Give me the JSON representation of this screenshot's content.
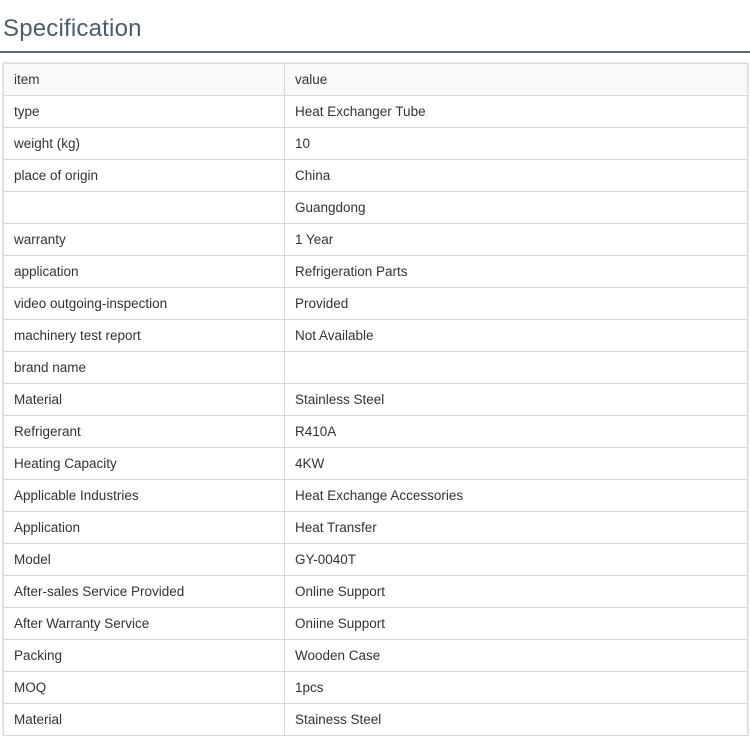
{
  "title": "Specification",
  "table": {
    "header": {
      "item": "item",
      "value": "value"
    },
    "rows": [
      {
        "item": "type",
        "value": "Heat Exchanger Tube"
      },
      {
        "item": "weight (kg)",
        "value": "10"
      },
      {
        "item": "place of origin",
        "value": "China"
      },
      {
        "item": "",
        "value": "Guangdong"
      },
      {
        "item": "warranty",
        "value": "1 Year"
      },
      {
        "item": "application",
        "value": "Refrigeration Parts"
      },
      {
        "item": "video outgoing-inspection",
        "value": "Provided"
      },
      {
        "item": "machinery test report",
        "value": "Not Available"
      },
      {
        "item": "brand name",
        "value": ""
      },
      {
        "item": "Material",
        "value": "Stainless Steel"
      },
      {
        "item": "Refrigerant",
        "value": "R410A"
      },
      {
        "item": "Heating Capacity",
        "value": "4KW"
      },
      {
        "item": "Applicable Industries",
        "value": "Heat Exchange Accessories"
      },
      {
        "item": "Application",
        "value": "Heat Transfer"
      },
      {
        "item": "Model",
        "value": "GY-0040T"
      },
      {
        "item": "After-sales Service Provided",
        "value": "Online Support"
      },
      {
        "item": "After Warranty Service",
        "value": "Oniine Support"
      },
      {
        "item": "Packing",
        "value": "Wooden Case"
      },
      {
        "item": "MOQ",
        "value": "1pcs"
      },
      {
        "item": "Material",
        "value": "Stainess Steel"
      }
    ]
  }
}
